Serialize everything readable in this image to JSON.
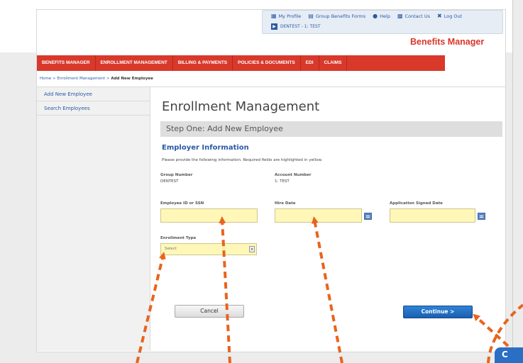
{
  "utility": {
    "links": [
      {
        "label": "My Profile",
        "icon": "profile-icon"
      },
      {
        "label": "Group Benefits Forms",
        "icon": "forms-icon"
      },
      {
        "label": "Help",
        "icon": "help-icon"
      },
      {
        "label": "Contact Us",
        "icon": "contact-icon"
      },
      {
        "label": "Log Out",
        "icon": "logout-icon"
      }
    ],
    "group_label": "DENTEST - 1: TEST"
  },
  "brand": "Benefits Manager",
  "nav": {
    "items": [
      "BENEFITS MANAGER",
      "ENROLLMENT MANAGEMENT",
      "BILLING & PAYMENTS",
      "POLICIES & DOCUMENTS",
      "EDI",
      "CLAIMS"
    ]
  },
  "breadcrumb": {
    "home": "Home",
    "section": "Enrollment Management",
    "current": "Add New Employee"
  },
  "sidebar": {
    "items": [
      "Add New Employee",
      "Search Employees"
    ]
  },
  "main": {
    "title": "Enrollment Management",
    "step": "Step One: Add New Employee",
    "section": "Employer Information",
    "instructions": "Please provide the following information. Required fields are highlighted in yellow.",
    "group_number_label": "Group Number",
    "group_number_value": "DENTEST",
    "account_number_label": "Account Number",
    "account_number_value": "1: TEST",
    "employee_id_label": "Employee ID or SSN",
    "hire_date_label": "Hire Date",
    "app_signed_label": "Application Signed Date",
    "enrollment_type_label": "Enrollment Type",
    "enrollment_type_value": "Select",
    "cancel": "Cancel",
    "continue": "Continue >"
  },
  "corner_tab": "C",
  "colors": {
    "nav_red": "#d8392b",
    "brand_red": "#d9362b",
    "link_blue": "#2a5aa5",
    "required_yellow": "#fff7b8",
    "continue_blue": "#1b5fb1",
    "annotation_orange": "#e8641e"
  }
}
